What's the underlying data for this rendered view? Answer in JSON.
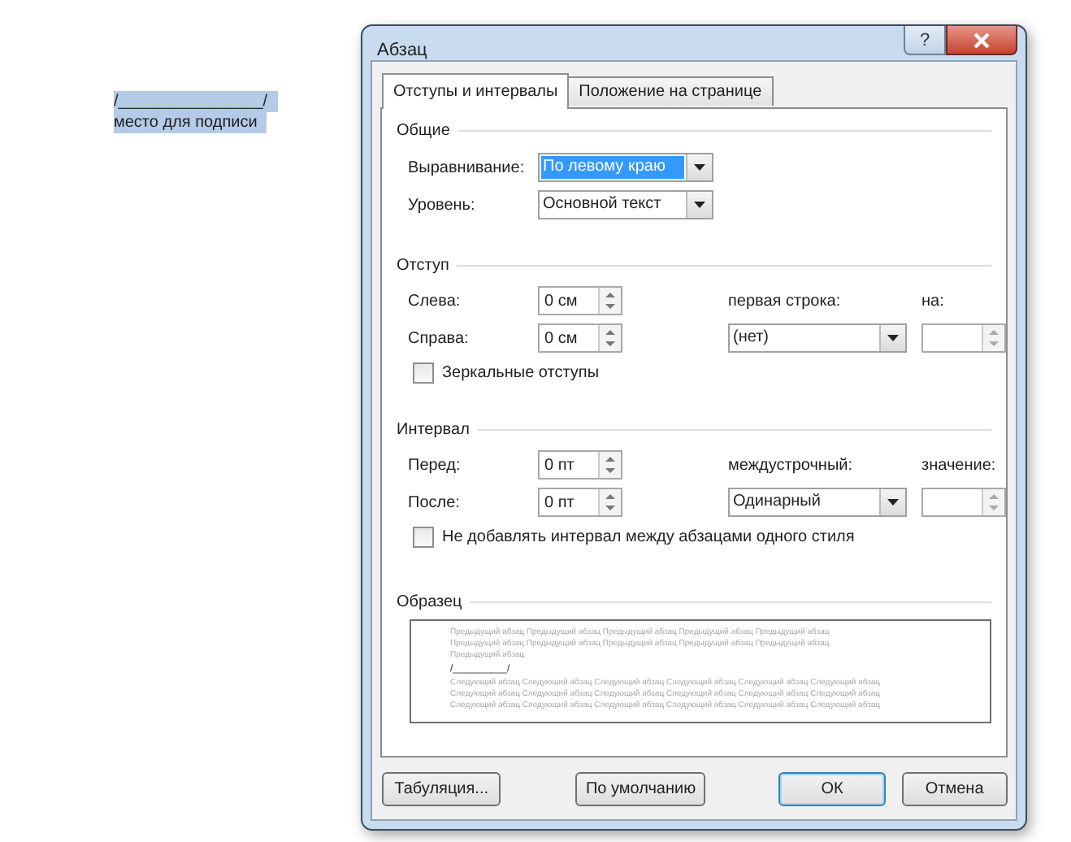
{
  "document": {
    "lines": [
      {
        "text": "/________________/",
        "selected": true
      },
      {
        "text": "место для подписи",
        "selected": true
      }
    ]
  },
  "window": {
    "title": "Абзац",
    "help": "?"
  },
  "tabs": [
    {
      "label": "Отступы и интервалы",
      "selected": true
    },
    {
      "label": "Положение на странице",
      "selected": false
    }
  ],
  "general": {
    "title": "Общие",
    "rows": [
      {
        "label": "Выравнивание:",
        "value": "По левому краю",
        "highlighted": true
      },
      {
        "label": "Уровень:",
        "value": "Основной текст",
        "highlighted": false
      }
    ]
  },
  "indent": {
    "title": "Отступ",
    "rows": [
      {
        "label": "Слева:",
        "value": "0 см"
      },
      {
        "label": "Справа:",
        "value": "0 см"
      }
    ],
    "side_label": "первая строка:",
    "side_value": "(нет)",
    "spin_label": "на:",
    "checkbox": {
      "label": "Зеркальные отступы",
      "checked": false
    }
  },
  "spacing": {
    "title": "Интервал",
    "rows": [
      {
        "label": "Перед:",
        "value": "0 пт"
      },
      {
        "label": "После:",
        "value": "0 пт"
      }
    ],
    "side_label": "междустрочный:",
    "side_value": "Одинарный",
    "spin_label": "значение:",
    "checkbox": {
      "label": "Не добавлять интервал между абзацами одного стиля",
      "checked": false
    }
  },
  "preview": {
    "title": "Образец",
    "before": [
      "Предыдущий абзац Предыдущий абзац Предыдущий абзац Предыдущий абзац Предыдущий абзац",
      "Предыдущий абзац Предыдущий абзац Предыдущий абзац Предыдущий абзац Предыдущий абзац",
      "Предыдущий абзац"
    ],
    "sample": "/__________/",
    "after": [
      "Следующий абзац Следующий абзац Следующий абзац Следующий абзац Следующий абзац Следующий абзац",
      "Следующий абзац Следующий абзац Следующий абзац Следующий абзац Следующий абзац Следующий абзац",
      "Следующий абзац Следующий абзац Следующий абзац Следующий абзац Следующий абзац Следующий абзац"
    ]
  },
  "buttons": [
    {
      "label": "Табуляция...",
      "default": false
    },
    {
      "label": "По умолчанию",
      "default": false
    },
    {
      "label": "ОК",
      "default": true
    },
    {
      "label": "Отмена",
      "default": false
    }
  ]
}
